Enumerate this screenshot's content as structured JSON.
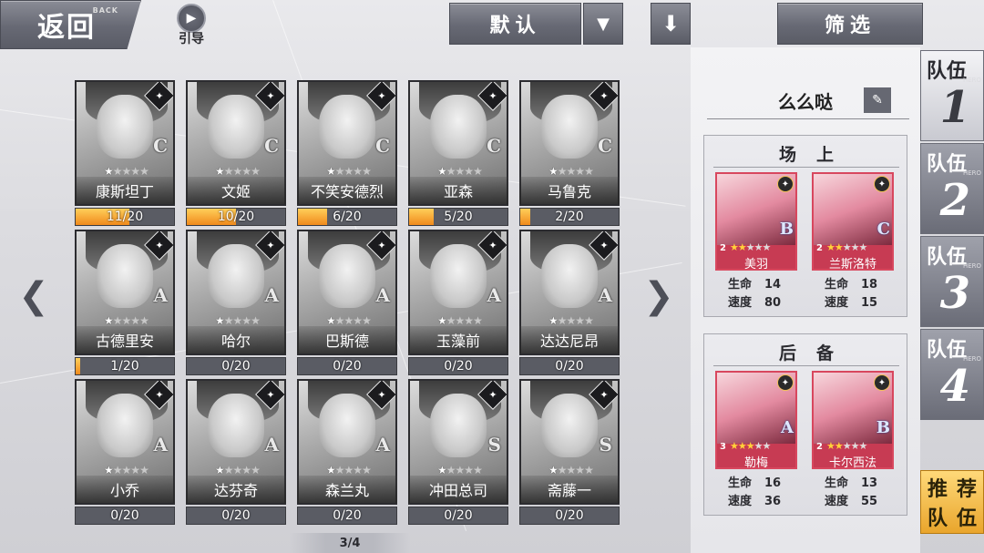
{
  "header": {
    "back_label": "返回",
    "back_sub": "BACK",
    "guide_label": "引导",
    "sort_label": "默认",
    "filter_label": "筛选"
  },
  "roster": [
    {
      "name": "康斯坦丁",
      "stars": 1,
      "rank": "C",
      "progress": "11/20",
      "fill": 0.55
    },
    {
      "name": "文姬",
      "stars": 1,
      "rank": "C",
      "progress": "10/20",
      "fill": 0.5
    },
    {
      "name": "不笑安德烈",
      "stars": 1,
      "rank": "C",
      "progress": "6/20",
      "fill": 0.3
    },
    {
      "name": "亚森",
      "stars": 1,
      "rank": "C",
      "progress": "5/20",
      "fill": 0.25
    },
    {
      "name": "马鲁克",
      "stars": 1,
      "rank": "C",
      "progress": "2/20",
      "fill": 0.1
    },
    {
      "name": "古德里安",
      "stars": 1,
      "rank": "A",
      "progress": "1/20",
      "fill": 0.05
    },
    {
      "name": "哈尔",
      "stars": 1,
      "rank": "A",
      "progress": "0/20",
      "fill": 0
    },
    {
      "name": "巴斯德",
      "stars": 1,
      "rank": "A",
      "progress": "0/20",
      "fill": 0
    },
    {
      "name": "玉藻前",
      "stars": 1,
      "rank": "A",
      "progress": "0/20",
      "fill": 0
    },
    {
      "name": "达达尼昂",
      "stars": 1,
      "rank": "A",
      "progress": "0/20",
      "fill": 0
    },
    {
      "name": "小乔",
      "stars": 1,
      "rank": "A",
      "progress": "0/20",
      "fill": 0
    },
    {
      "name": "达芬奇",
      "stars": 1,
      "rank": "A",
      "progress": "0/20",
      "fill": 0
    },
    {
      "name": "森兰丸",
      "stars": 1,
      "rank": "A",
      "progress": "0/20",
      "fill": 0
    },
    {
      "name": "冲田总司",
      "stars": 1,
      "rank": "S",
      "progress": "0/20",
      "fill": 0
    },
    {
      "name": "斋藤一",
      "stars": 1,
      "rank": "S",
      "progress": "0/20",
      "fill": 0
    }
  ],
  "pagination": "3/4",
  "team": {
    "name": "么么哒",
    "onfield_title": "场上",
    "bench_title": "后备",
    "stat_hp_label": "生命",
    "stat_speed_label": "速度",
    "onfield": [
      {
        "name": "美羽",
        "level": "2",
        "stars": 2,
        "rank": "B",
        "hp": "14",
        "speed": "80"
      },
      {
        "name": "兰斯洛特",
        "level": "2",
        "stars": 2,
        "rank": "C",
        "hp": "18",
        "speed": "15"
      }
    ],
    "bench": [
      {
        "name": "勒梅",
        "level": "3",
        "stars": 3,
        "rank": "A",
        "hp": "16",
        "speed": "36"
      },
      {
        "name": "卡尔西法",
        "level": "2",
        "stars": 2,
        "rank": "B",
        "hp": "13",
        "speed": "55"
      }
    ]
  },
  "tabs": [
    {
      "label": "队伍",
      "sub": "HERO",
      "num": "1",
      "active": true
    },
    {
      "label": "队伍",
      "sub": "HERO",
      "num": "2",
      "active": false
    },
    {
      "label": "队伍",
      "sub": "HERO",
      "num": "3",
      "active": false
    },
    {
      "label": "队伍",
      "sub": "HERO",
      "num": "4",
      "active": false
    }
  ],
  "recommend": [
    "推",
    "荐",
    "队",
    "伍"
  ],
  "colors": {
    "accent": "#f08a1c",
    "hero_frame": "#c73b53",
    "recommend": "#e9a52c"
  }
}
